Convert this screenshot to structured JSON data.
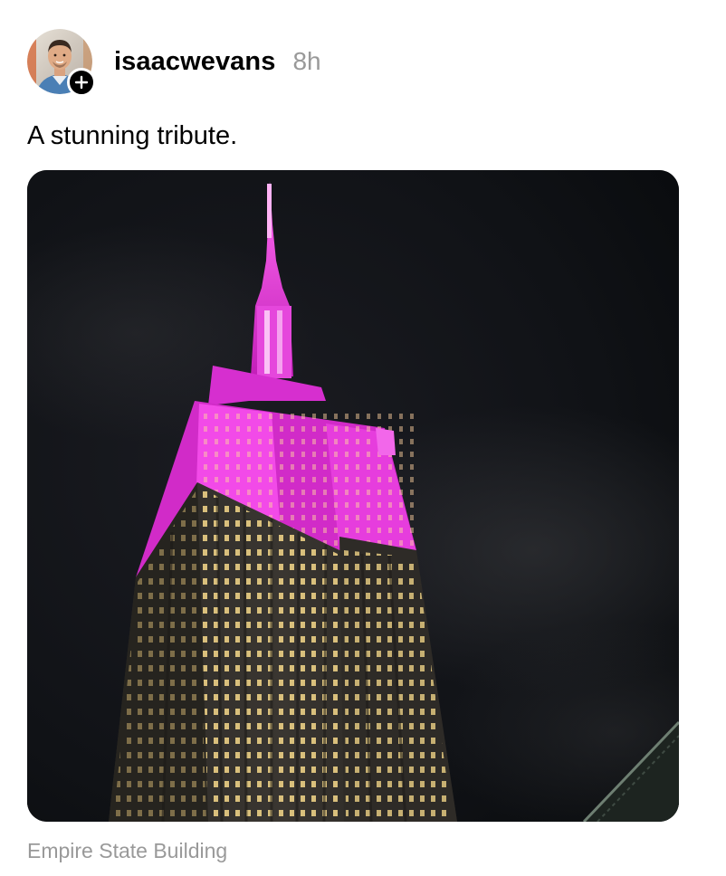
{
  "post": {
    "author": {
      "username": "isaacwevans",
      "avatar_icon": "profile-photo",
      "follow_icon": "plus-icon"
    },
    "timestamp": "8h",
    "caption": "A stunning tribute.",
    "image": {
      "subject_icon": "empire-state-building-night-photo",
      "accent_color": "#e13ad6"
    },
    "location": "Empire State Building"
  }
}
